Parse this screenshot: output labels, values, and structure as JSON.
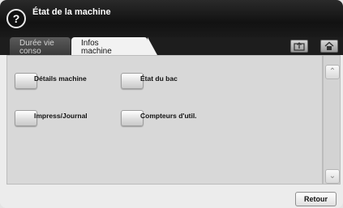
{
  "header": {
    "help_icon_label": "?",
    "title": "État de la machine"
  },
  "tabs": [
    {
      "label_line1": "Durée vie",
      "label_line2": "conso",
      "active": false
    },
    {
      "label_line1": "Infos",
      "label_line2": "machine",
      "active": true
    }
  ],
  "toolbar_icons": [
    "job-status-icon",
    "home-icon"
  ],
  "items": [
    {
      "label": "Détails machine"
    },
    {
      "label": "État du bac"
    },
    {
      "label": "Impress/Journal"
    },
    {
      "label": "Compteurs d'util."
    }
  ],
  "scroll": {
    "up_glyph": "⌃",
    "down_glyph": "⌄"
  },
  "footer": {
    "return_label": "Retour"
  }
}
